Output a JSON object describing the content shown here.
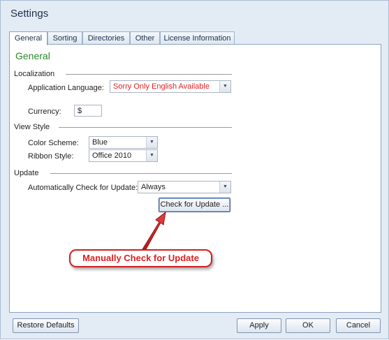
{
  "window": {
    "title": "Settings"
  },
  "tabs": [
    {
      "label": "General"
    },
    {
      "label": "Sorting"
    },
    {
      "label": "Directories"
    },
    {
      "label": "Other"
    },
    {
      "label": "License Information"
    }
  ],
  "general": {
    "heading": "General",
    "localization": {
      "title": "Localization",
      "language_label": "Application Language:",
      "language_value": "Sorry Only English Available",
      "currency_label": "Currency:",
      "currency_value": "$"
    },
    "view_style": {
      "title": "View Style",
      "color_scheme_label": "Color Scheme:",
      "color_scheme_value": "Blue",
      "ribbon_style_label": "Ribbon Style:",
      "ribbon_style_value": "Office 2010"
    },
    "update": {
      "title": "Update",
      "auto_check_label": "Automatically Check for Update:",
      "auto_check_value": "Always",
      "check_button": "Check for Update ..."
    }
  },
  "annotation": {
    "text": "Manually Check for Update",
    "color": "#e02020"
  },
  "footer": {
    "restore_defaults": "Restore Defaults",
    "apply": "Apply",
    "ok": "OK",
    "cancel": "Cancel"
  },
  "colors": {
    "heading_green": "#2a8a2a",
    "language_red": "#e02020",
    "window_bg": "#e3ebf5"
  }
}
